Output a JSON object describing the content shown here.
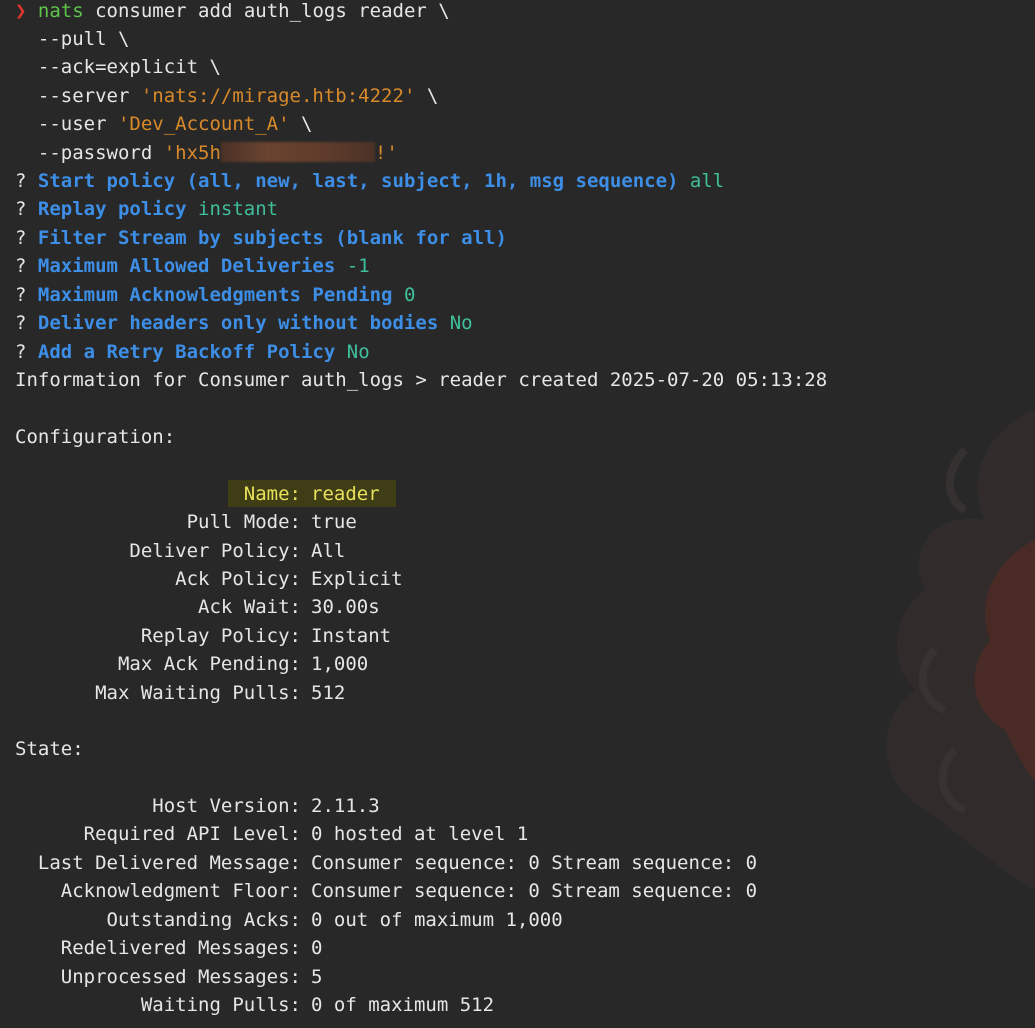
{
  "command": {
    "prompt_symbol": "❯",
    "program": "nats",
    "first_line_rest": " consumer add auth_logs reader \\",
    "lines": [
      "  --pull \\",
      "  --ack=explicit \\"
    ],
    "server_flag": "  --server ",
    "server_value": "'nats://mirage.htb:4222'",
    "server_tail": " \\",
    "user_flag": "  --user ",
    "user_value": "'Dev_Account_A'",
    "user_tail": " \\",
    "password_flag": "  --password ",
    "password_prefix": "'hx5h",
    "password_suffix": "!'"
  },
  "prompts": [
    {
      "mark": "? ",
      "question": "Start policy (all, new, last, subject, 1h, msg sequence)",
      "answer": " all"
    },
    {
      "mark": "? ",
      "question": "Replay policy",
      "answer": " instant"
    },
    {
      "mark": "? ",
      "question": "Filter Stream by subjects (blank for all)",
      "answer": ""
    },
    {
      "mark": "? ",
      "question": "Maximum Allowed Deliveries",
      "answer": " -1"
    },
    {
      "mark": "? ",
      "question": "Maximum Acknowledgments Pending",
      "answer": " 0"
    },
    {
      "mark": "? ",
      "question": "Deliver headers only without bodies",
      "answer": " No"
    },
    {
      "mark": "? ",
      "question": "Add a Retry Backoff Policy",
      "answer": " No"
    }
  ],
  "info_line": "Information for Consumer auth_logs > reader created 2025-07-20 05:13:28",
  "configuration": {
    "heading": "Configuration:",
    "rows": [
      {
        "key": "Name:",
        "value": "reader"
      },
      {
        "key": "Pull Mode:",
        "value": "true"
      },
      {
        "key": "Deliver Policy:",
        "value": "All"
      },
      {
        "key": "Ack Policy:",
        "value": "Explicit"
      },
      {
        "key": "Ack Wait:",
        "value": "30.00s"
      },
      {
        "key": "Replay Policy:",
        "value": "Instant"
      },
      {
        "key": "Max Ack Pending:",
        "value": "1,000"
      },
      {
        "key": "Max Waiting Pulls:",
        "value": "512"
      }
    ]
  },
  "state": {
    "heading": "State:",
    "rows": [
      {
        "key": "Host Version:",
        "value": "2.11.3"
      },
      {
        "key": "Required API Level:",
        "value": "0 hosted at level 1"
      },
      {
        "key": "Last Delivered Message:",
        "value": "Consumer sequence: 0 Stream sequence: 0"
      },
      {
        "key": "Acknowledgment Floor:",
        "value": "Consumer sequence: 0 Stream sequence: 0"
      },
      {
        "key": "Outstanding Acks:",
        "value": "0 out of maximum 1,000"
      },
      {
        "key": "Redelivered Messages:",
        "value": "0"
      },
      {
        "key": "Unprocessed Messages:",
        "value": "5"
      },
      {
        "key": "Waiting Pulls:",
        "value": "0 of maximum 512"
      }
    ]
  },
  "colors": {
    "background": "#282828",
    "prompt": "#e0352b",
    "command": "#5ec44b",
    "string": "#d88a2a",
    "question": "#3d8ee6",
    "answer": "#3fbf9a",
    "highlight_bg": "#3e3d16",
    "highlight_fg": "#e8e05a"
  }
}
